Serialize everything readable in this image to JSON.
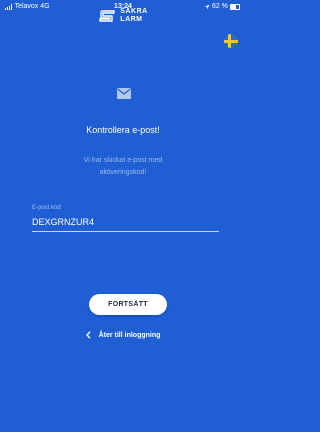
{
  "status_bar": {
    "carrier": "Telavox",
    "network": "4G",
    "time": "13:24",
    "battery": "62 %"
  },
  "logo": {
    "line1": "SÄKRA",
    "line2": "LARM"
  },
  "language": {
    "icon": "swedish-flag-icon",
    "colors": {
      "blue": "#2d6bc4",
      "yellow": "#f6c62c"
    }
  },
  "heading": "Kontrollera e-post!",
  "subtext": {
    "line1": "Vi har skickat e-post med",
    "line2": "aktiveringskod!"
  },
  "field": {
    "label": "E-post kod",
    "value": "DEXGRNZUR4"
  },
  "continue_label": "FORTSÄTT",
  "back_label": "Åter till inloggning",
  "colors": {
    "background": "#1f5fd3",
    "button": "#ffffff",
    "button_text": "#1c2a44"
  }
}
